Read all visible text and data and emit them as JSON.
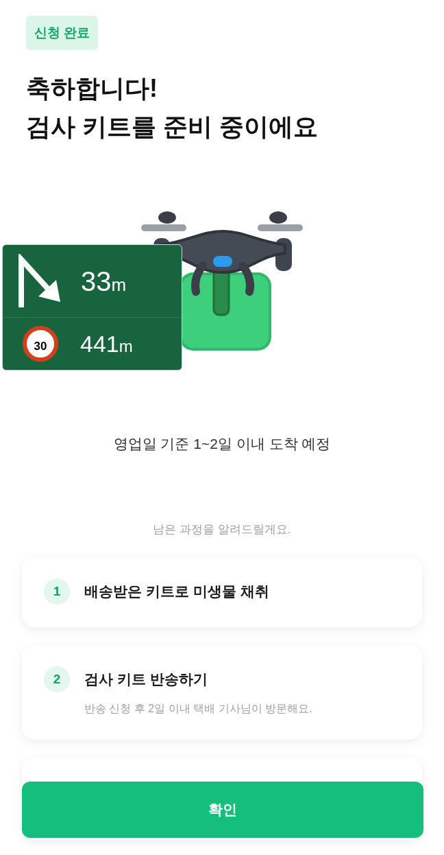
{
  "badge": "신청 완료",
  "title_lines": [
    "축하합니다!",
    "검사 키트를 준비 중이에요"
  ],
  "navigation_overlay": {
    "turn_distance": "33",
    "turn_unit": "m",
    "speed_limit": "30",
    "camera_distance": "441",
    "camera_unit": "m"
  },
  "arrival_note": "영업일 기준 1~2일 이내 도착 예정",
  "steps_intro": "남은 과정을 알려드릴게요.",
  "steps": [
    {
      "number": "1",
      "title": "배송받은 키트로 미생물 채취"
    },
    {
      "number": "2",
      "title": "검사 키트 반송하기",
      "note": "반송 신청 후 2일 이내 택배 기사님이 방문해요."
    }
  ],
  "confirm_button": "확인"
}
